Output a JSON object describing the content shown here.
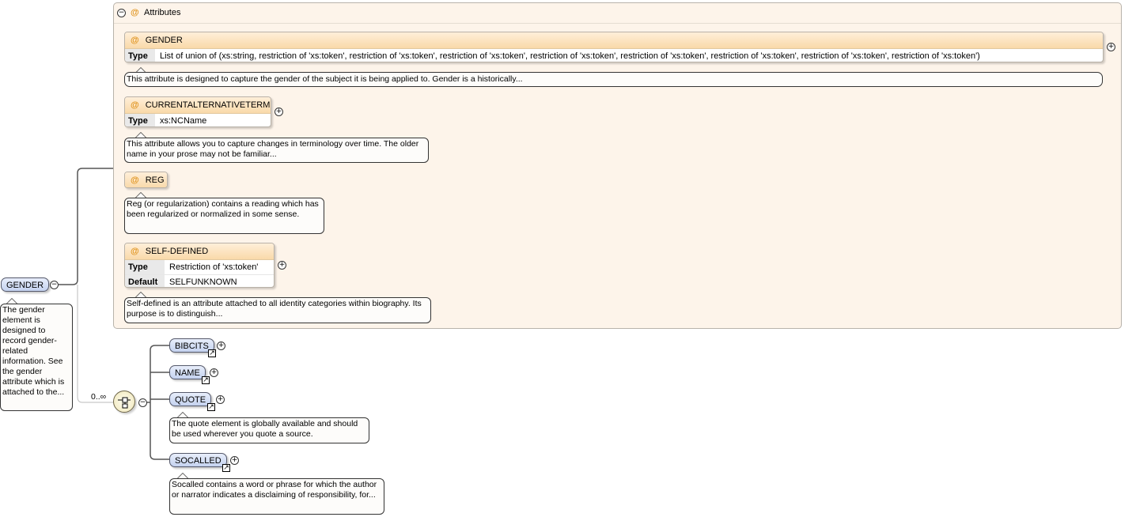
{
  "root": {
    "name": "GENDER",
    "doc": "The gender element is designed to record gender-related information. See the gender attribute which is attached to the..."
  },
  "attributes_group": {
    "title": "Attributes",
    "items": [
      {
        "name": "GENDER",
        "rows": [
          {
            "key": "Type",
            "value": "List of union of (xs:string, restriction of 'xs:token', restriction of 'xs:token', restriction of 'xs:token', restriction of 'xs:token', restriction of 'xs:token', restriction of 'xs:token', restriction of 'xs:token', restriction of 'xs:token')"
          }
        ],
        "doc": "This attribute is designed to capture the gender of the subject it is being applied to. Gender is a historically..."
      },
      {
        "name": "CURRENTALTERNATIVETERM",
        "rows": [
          {
            "key": "Type",
            "value": "xs:NCName"
          }
        ],
        "doc": "This attribute allows you to capture changes in terminology over time. The older name in your prose may not be familiar..."
      },
      {
        "name": "REG",
        "rows": [],
        "doc": "Reg (or regularization) contains a reading which has been regularized or normalized in some sense."
      },
      {
        "name": "SELF-DEFINED",
        "rows": [
          {
            "key": "Type",
            "value": "Restriction of 'xs:token'"
          },
          {
            "key": "Default",
            "value": "SELFUNKNOWN"
          }
        ],
        "doc": "Self-defined is an attribute attached to all identity categories within biography. Its purpose is to distinguish..."
      }
    ]
  },
  "content_model": {
    "occurrence": "0..∞",
    "children": [
      {
        "name": "BIBCITS",
        "doc": ""
      },
      {
        "name": "NAME",
        "doc": ""
      },
      {
        "name": "QUOTE",
        "doc": "The quote element is globally available and should be used wherever you quote a source."
      },
      {
        "name": "SOCALLED",
        "doc": "Socalled contains a word or phrase for which the author or narrator indicates a disclaiming of responsibility, for..."
      }
    ]
  },
  "icons": {
    "collapse": "collapse-icon",
    "expand": "expand-icon",
    "attribute": "attribute-at-icon",
    "reference": "reference-arrow-icon",
    "choice": "choice-compositor-icon"
  }
}
